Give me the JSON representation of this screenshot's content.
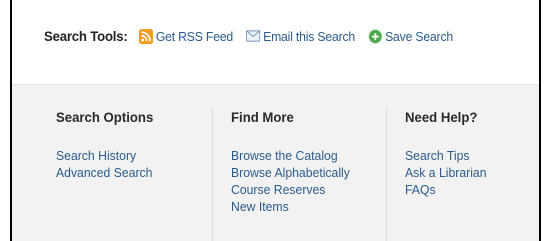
{
  "toolbar": {
    "label": "Search Tools:",
    "tools": [
      {
        "label": "Get RSS Feed",
        "icon": "rss-icon"
      },
      {
        "label": "Email this Search",
        "icon": "email-icon"
      },
      {
        "label": "Save Search",
        "icon": "save-plus-icon"
      }
    ]
  },
  "columns": [
    {
      "heading": "Search Options",
      "links": [
        "Search History",
        "Advanced Search"
      ]
    },
    {
      "heading": "Find More",
      "links": [
        "Browse the Catalog",
        "Browse Alphabetically",
        "Course Reserves",
        "New Items"
      ]
    },
    {
      "heading": "Need Help?",
      "links": [
        "Search Tips",
        "Ask a Librarian",
        "FAQs"
      ]
    }
  ],
  "colors": {
    "link": "#2b5b8a",
    "rss": "#f39a21",
    "save": "#4aa84a",
    "panel": "#f2f2f2"
  }
}
